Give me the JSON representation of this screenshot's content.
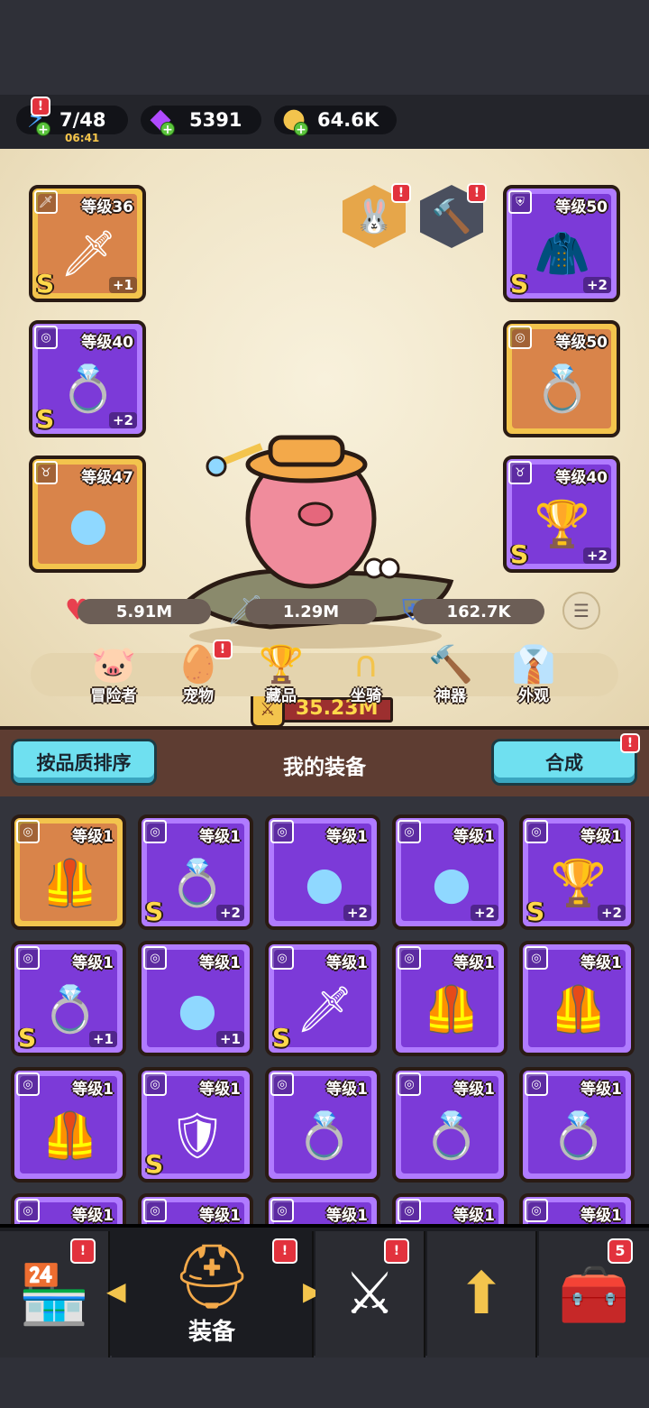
{
  "resources": {
    "energy": {
      "value": "7/48",
      "timer": "06:41",
      "icon": "lightning-icon"
    },
    "gems": {
      "value": "5391",
      "icon": "gem-icon"
    },
    "coins": {
      "value": "64.6K",
      "icon": "coin-icon"
    }
  },
  "equipped": {
    "weapon": {
      "level": "等级36",
      "grade": "S",
      "bonus": "+1",
      "rarity": "gold",
      "icon": "sword-icon"
    },
    "ring_left": {
      "level": "等级40",
      "grade": "S",
      "bonus": "+2",
      "rarity": "purple",
      "icon": "ring-icon"
    },
    "necklace_left": {
      "level": "等级47",
      "grade": "",
      "bonus": "",
      "rarity": "gold",
      "icon": "necklace-icon"
    },
    "armor": {
      "level": "等级50",
      "grade": "S",
      "bonus": "+2",
      "rarity": "purple",
      "icon": "robe-icon"
    },
    "ring_right": {
      "level": "等级50",
      "grade": "",
      "bonus": "",
      "rarity": "gold",
      "icon": "ring-icon"
    },
    "necklace_right": {
      "level": "等级40",
      "grade": "S",
      "bonus": "+2",
      "rarity": "purple",
      "icon": "goblet-icon"
    }
  },
  "power": "35.23M",
  "stats": {
    "hp": "5.91M",
    "attack": "1.29M",
    "defense": "162.7K"
  },
  "tabs": [
    "冒险者",
    "宠物",
    "藏品",
    "坐骑",
    "神器",
    "外观"
  ],
  "equip_section": {
    "sort_label": "按品质排序",
    "title": "我的装备",
    "merge_label": "合成"
  },
  "inventory": [
    {
      "level": "等级1",
      "grade": "",
      "bonus": "",
      "rarity": "gold",
      "icon": "chest-armor-icon"
    },
    {
      "level": "等级1",
      "grade": "S",
      "bonus": "+2",
      "rarity": "purple",
      "icon": "ring-icon"
    },
    {
      "level": "等级1",
      "grade": "",
      "bonus": "+2",
      "rarity": "purple",
      "icon": "necklace-icon"
    },
    {
      "level": "等级1",
      "grade": "",
      "bonus": "+2",
      "rarity": "purple",
      "icon": "necklace-icon"
    },
    {
      "level": "等级1",
      "grade": "S",
      "bonus": "+2",
      "rarity": "purple",
      "icon": "goblet-icon"
    },
    {
      "level": "等级1",
      "grade": "S",
      "bonus": "+1",
      "rarity": "purple",
      "icon": "ring-icon"
    },
    {
      "level": "等级1",
      "grade": "",
      "bonus": "+1",
      "rarity": "purple",
      "icon": "necklace-icon"
    },
    {
      "level": "等级1",
      "grade": "S",
      "bonus": "",
      "rarity": "purple",
      "icon": "spear-icon"
    },
    {
      "level": "等级1",
      "grade": "",
      "bonus": "",
      "rarity": "purple",
      "icon": "chest-armor-icon"
    },
    {
      "level": "等级1",
      "grade": "",
      "bonus": "",
      "rarity": "purple",
      "icon": "chest-armor-icon"
    },
    {
      "level": "等级1",
      "grade": "",
      "bonus": "",
      "rarity": "purple",
      "icon": "chest-armor-icon"
    },
    {
      "level": "等级1",
      "grade": "S",
      "bonus": "",
      "rarity": "purple",
      "icon": "dark-armor-icon"
    },
    {
      "level": "等级1",
      "grade": "",
      "bonus": "",
      "rarity": "purple",
      "icon": "ring-icon"
    },
    {
      "level": "等级1",
      "grade": "",
      "bonus": "",
      "rarity": "purple",
      "icon": "ring-icon"
    },
    {
      "level": "等级1",
      "grade": "",
      "bonus": "",
      "rarity": "purple",
      "icon": "ring-icon"
    },
    {
      "level": "等级1",
      "grade": "",
      "bonus": "",
      "rarity": "purple",
      "icon": "ring-icon"
    },
    {
      "level": "等级1",
      "grade": "",
      "bonus": "",
      "rarity": "purple",
      "icon": "ring-icon"
    },
    {
      "level": "等级1",
      "grade": "",
      "bonus": "",
      "rarity": "purple",
      "icon": "ring-icon"
    },
    {
      "level": "等级1",
      "grade": "",
      "bonus": "",
      "rarity": "purple",
      "icon": "ring-icon"
    },
    {
      "level": "等级1",
      "grade": "",
      "bonus": "",
      "rarity": "purple",
      "icon": "ring-icon"
    }
  ],
  "bottom_nav": {
    "active_label": "装备",
    "chest_badge": "5"
  }
}
